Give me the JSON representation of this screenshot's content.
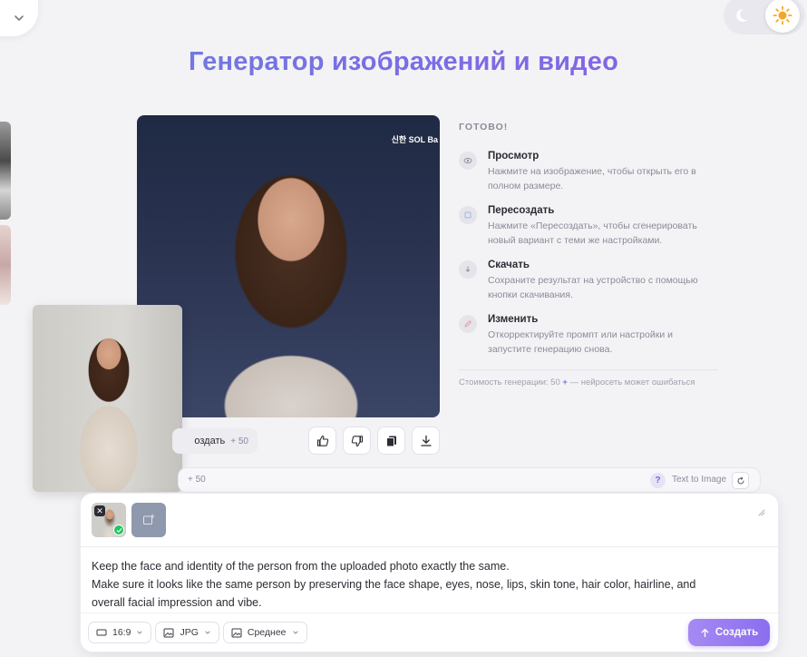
{
  "header": {
    "title": "Генератор изображений и видео"
  },
  "result": {
    "image_badge": "신한 SOL Ba",
    "recreate_label": "оздать",
    "recreate_cost": "+ 50"
  },
  "info": {
    "status": "ГОТОВО!",
    "items": [
      {
        "title": "Просмотр",
        "desc": "Нажмите на изображение, чтобы открыть его в полном размере.",
        "icon": "eye-icon"
      },
      {
        "title": "Пересоздать",
        "desc": "Нажмите «Пересоздать», чтобы сгенерировать новый вариант с теми же настройками.",
        "icon": "refresh-icon"
      },
      {
        "title": "Скачать",
        "desc": "Сохраните результат на устройство с помощью кнопки скачивания.",
        "icon": "download-icon"
      },
      {
        "title": "Изменить",
        "desc": "Откорректируйте промпт или настройки и запустите генерацию снова.",
        "icon": "pencil-icon"
      }
    ],
    "footer_prefix": "Стоимость генерации: 50",
    "footer_plus": "+",
    "footer_suffix": "— нейросеть может ошибаться"
  },
  "toolbar": {
    "cost": "+ 50",
    "help": "?",
    "mode": "Text to Image"
  },
  "composer": {
    "prompt_line1": "Keep the face and identity of the person from the uploaded photo exactly the same.",
    "prompt_line2": "Make sure it looks like the same person by preserving the face shape, eyes, nose, lips, skin tone, hair color, hairline, and",
    "prompt_line3": "overall facial impression and vibe.",
    "options": {
      "aspect": "16:9",
      "format": "JPG",
      "quality": "Среднее"
    },
    "submit_label": "Создать"
  },
  "colors": {
    "accent": "#8a6ef0",
    "title_gradient_start": "#6e7fe0",
    "title_gradient_end": "#8a5fe6",
    "success": "#22c55e"
  }
}
